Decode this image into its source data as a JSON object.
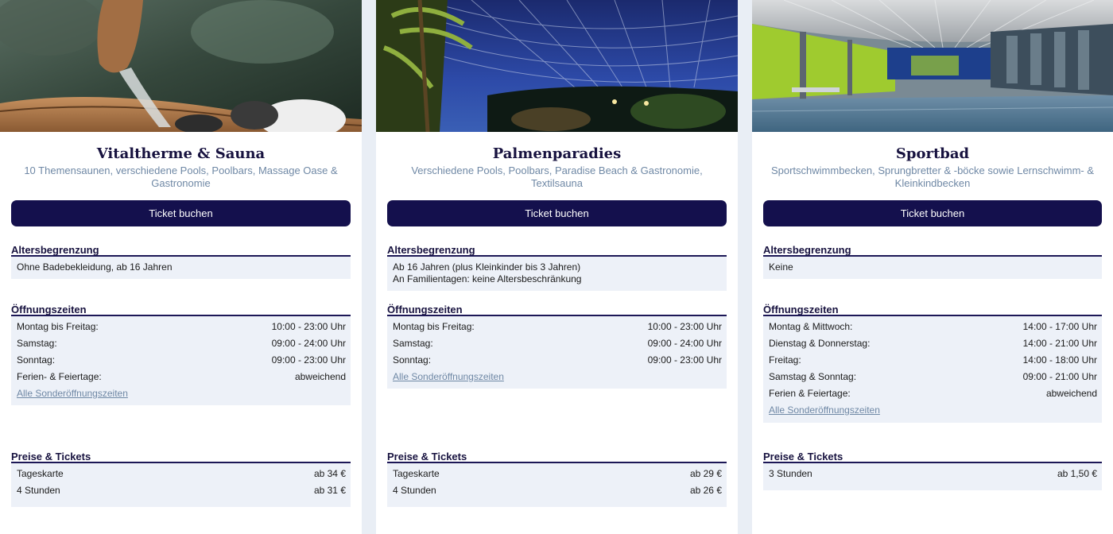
{
  "cards": [
    {
      "title": "Vitaltherme & Sauna",
      "subtitle": "10 Themensaunen, verschiedene Pools, Poolbars, Massage Oase & Gastronomie",
      "button": "Ticket buchen",
      "age": {
        "heading": "Altersbegrenzung",
        "lines": [
          "Ohne Badebekleidung, ab 16 Jahren"
        ]
      },
      "hours": {
        "heading": "Öffnungszeiten",
        "rows": [
          {
            "label": "Montag bis Freitag:",
            "value": "10:00 - 23:00 Uhr"
          },
          {
            "label": "Samstag:",
            "value": "09:00 - 24:00 Uhr"
          },
          {
            "label": "Sonntag:",
            "value": "09:00 - 23:00 Uhr"
          },
          {
            "label": "Ferien- & Feiertage:",
            "value": "abweichend"
          }
        ],
        "link": "Alle Sonderöffnungszeiten"
      },
      "prices": {
        "heading": "Preise & Tickets",
        "rows": [
          {
            "label": "Tageskarte",
            "value": "ab 34 €"
          },
          {
            "label": "4 Stunden",
            "value": "ab 31 €"
          }
        ]
      }
    },
    {
      "title": "Palmenparadies",
      "subtitle": "Verschiedene Pools, Poolbars, Paradise Beach & Gastronomie, Textilsauna",
      "button": "Ticket buchen",
      "age": {
        "heading": "Altersbegrenzung",
        "lines": [
          "Ab 16 Jahren (plus Kleinkinder bis 3 Jahren)",
          "An Familientagen: keine Altersbeschränkung"
        ]
      },
      "hours": {
        "heading": "Öffnungszeiten",
        "rows": [
          {
            "label": "Montag bis Freitag:",
            "value": "10:00 - 23:00 Uhr"
          },
          {
            "label": "Samstag:",
            "value": "09:00 - 24:00 Uhr"
          },
          {
            "label": "Sonntag:",
            "value": "09:00 - 23:00 Uhr"
          }
        ],
        "link": "Alle Sonderöffnungszeiten"
      },
      "prices": {
        "heading": "Preise & Tickets",
        "rows": [
          {
            "label": "Tageskarte",
            "value": "ab 29 €"
          },
          {
            "label": "4 Stunden",
            "value": "ab 26 €"
          }
        ]
      }
    },
    {
      "title": "Sportbad",
      "subtitle": "Sportschwimmbecken, Sprungbretter & -böcke sowie Lernschwimm- & Kleinkindbecken",
      "button": "Ticket buchen",
      "age": {
        "heading": "Altersbegrenzung",
        "lines": [
          "Keine"
        ]
      },
      "hours": {
        "heading": "Öffnungszeiten",
        "rows": [
          {
            "label": "Montag & Mittwoch:",
            "value": "14:00 - 17:00 Uhr"
          },
          {
            "label": "Dienstag & Donnerstag:",
            "value": "14:00 - 21:00 Uhr"
          },
          {
            "label": "Freitag:",
            "value": "14:00 - 18:00 Uhr"
          },
          {
            "label": "Samstag & Sonntag:",
            "value": "09:00 - 21:00 Uhr"
          },
          {
            "label": "Ferien & Feiertage:",
            "value": "abweichend"
          }
        ],
        "link": "Alle Sonderöffnungszeiten"
      },
      "prices": {
        "heading": "Preise & Tickets",
        "rows": [
          {
            "label": "3 Stunden",
            "value": "ab 1,50 €"
          }
        ]
      }
    }
  ]
}
